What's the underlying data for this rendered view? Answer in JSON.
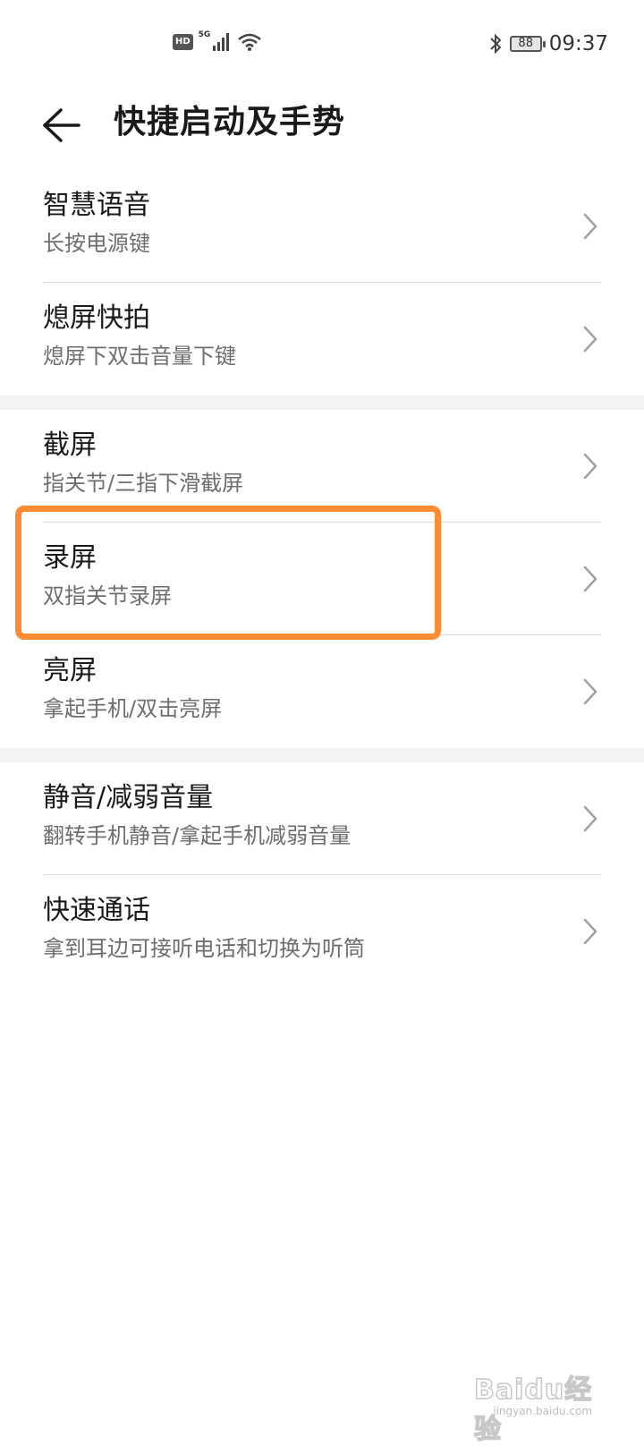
{
  "status_bar": {
    "hd": "HD",
    "network": "5G",
    "battery": "88",
    "time": "09:37",
    "icons": [
      "hd-icon",
      "signal-icon",
      "wifi-icon",
      "bluetooth-icon",
      "battery-icon"
    ]
  },
  "header": {
    "title": "快捷启动及手势",
    "back_icon": "back-arrow-icon"
  },
  "groups": [
    {
      "items": [
        {
          "title": "智慧语音",
          "subtitle": "长按电源键"
        },
        {
          "title": "熄屏快拍",
          "subtitle": "熄屏下双击音量下键"
        }
      ]
    },
    {
      "items": [
        {
          "title": "截屏",
          "subtitle": "指关节/三指下滑截屏"
        },
        {
          "title": "录屏",
          "subtitle": "双指关节录屏"
        },
        {
          "title": "亮屏",
          "subtitle": "拿起手机/双击亮屏"
        }
      ]
    },
    {
      "items": [
        {
          "title": "静音/减弱音量",
          "subtitle": "翻转手机静音/拿起手机减弱音量"
        },
        {
          "title": "快速通话",
          "subtitle": "拿到耳边可接听电话和切换为听筒"
        }
      ]
    }
  ],
  "colors": {
    "highlight": "#ff8c33",
    "divider": "#dcdcdc",
    "group_gap": "#f1f3f5",
    "subtitle": "#6e6e6e"
  },
  "watermark": {
    "logo": "Baidu经验",
    "url": "jingyan.baidu.com"
  }
}
